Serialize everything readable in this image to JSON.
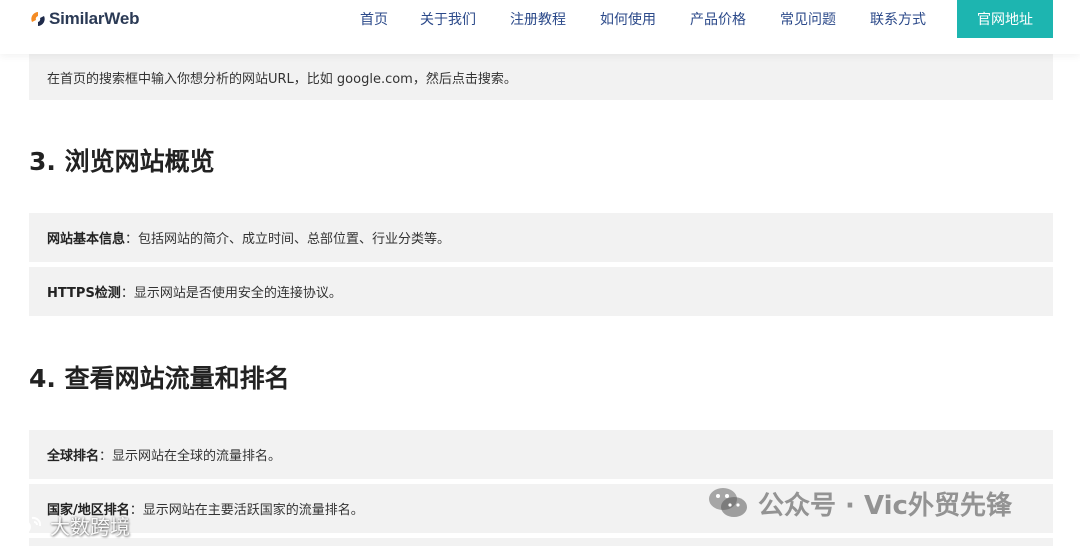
{
  "header": {
    "logo_text": "SimilarWeb",
    "nav": [
      "首页",
      "关于我们",
      "注册教程",
      "如何使用",
      "产品价格",
      "常见问题",
      "联系方式"
    ],
    "cta": "官网地址"
  },
  "content": {
    "top_box_text": "在首页的搜索框中输入你想分析的网站URL，比如 google.com，然后点击搜索。",
    "section3": {
      "heading": "3. 浏览网站概览",
      "items": [
        {
          "label": "网站基本信息",
          "text": "：包括网站的简介、成立时间、总部位置、行业分类等。"
        },
        {
          "label": "HTTPS检测",
          "text": "：显示网站是否使用安全的连接协议。"
        }
      ]
    },
    "section4": {
      "heading": "4. 查看网站流量和排名",
      "items": [
        {
          "label": "全球排名",
          "text": "：显示网站在全球的流量排名。"
        },
        {
          "label": "国家/地区排名",
          "text": "：显示网站在主要活跃国家的流量排名。"
        }
      ]
    }
  },
  "watermarks": {
    "right": "公众号 · Vic外贸先锋",
    "left": "大数跨境"
  },
  "colors": {
    "accent": "#1db5b0",
    "nav_text": "#2c4a8a",
    "box_bg": "#f2f2f2"
  },
  "icons": [
    "similarweb-logo-icon",
    "wechat-icon",
    "weibo-icon"
  ]
}
